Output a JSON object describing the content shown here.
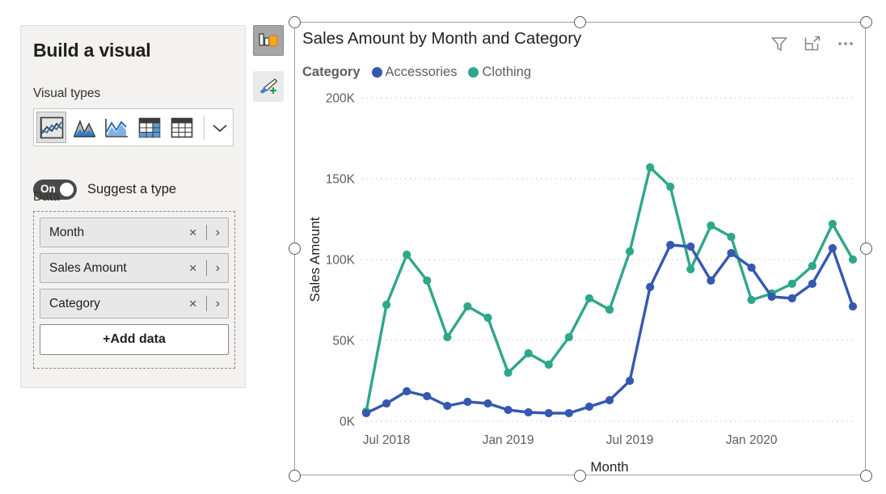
{
  "build_pane": {
    "title": "Build a visual",
    "visual_types_label": "Visual types",
    "data_label": "Data",
    "visual_types": [
      {
        "name": "line-chart",
        "selected": true
      },
      {
        "name": "area-chart",
        "selected": false
      },
      {
        "name": "line-and-stacked-area-chart",
        "selected": false
      },
      {
        "name": "matrix",
        "selected": false
      },
      {
        "name": "table",
        "selected": false
      }
    ],
    "more_visual_types_icon": "chevron-down-icon",
    "suggest_toggle": {
      "state_text": "On",
      "label": "Suggest a type",
      "on": true
    },
    "fields": [
      {
        "name": "Month",
        "remove_icon": "×",
        "expand_icon": "›"
      },
      {
        "name": "Sales Amount",
        "remove_icon": "×",
        "expand_icon": "›"
      },
      {
        "name": "Category",
        "remove_icon": "×",
        "expand_icon": "›"
      }
    ],
    "add_data_label": "+Add data"
  },
  "rail": {
    "build_icon": "build-visual-icon",
    "format_icon": "format-paint-brush-icon"
  },
  "visual": {
    "title": "Sales Amount by Month and Category",
    "header_icons": [
      {
        "name": "filter-icon"
      },
      {
        "name": "focus-mode-icon"
      },
      {
        "name": "more-options-icon",
        "label": "•••"
      }
    ]
  },
  "colors": {
    "accessories": "#3559b0",
    "clothing": "#2fa78a",
    "gridline": "#d4d2d0",
    "axis_text": "#605e5c",
    "title_text": "#252423",
    "pane_bg": "#f3f2f1",
    "frame_border": "#9e9e9e"
  },
  "chart_data": {
    "type": "line",
    "title": "Sales Amount by Month and Category",
    "xlabel": "Month",
    "ylabel": "Sales Amount",
    "legend_title": "Category",
    "legend_position": "top",
    "grid": true,
    "ylim": [
      0,
      200000
    ],
    "yticks": [
      0,
      50000,
      100000,
      150000,
      200000
    ],
    "ytick_labels": [
      "0K",
      "50K",
      "100K",
      "150K",
      "200K"
    ],
    "xtick_labels": [
      "Jul 2018",
      "Jan 2019",
      "Jul 2019",
      "Jan 2020"
    ],
    "xtick_indices": [
      1,
      7,
      13,
      19
    ],
    "x": [
      "Jun 2018",
      "Jul 2018",
      "Aug 2018",
      "Sep 2018",
      "Oct 2018",
      "Nov 2018",
      "Dec 2018",
      "Jan 2019",
      "Feb 2019",
      "Mar 2019",
      "Apr 2019",
      "May 2019",
      "Jun 2019",
      "Jul 2019",
      "Aug 2019",
      "Sep 2019",
      "Oct 2019",
      "Nov 2019",
      "Dec 2019",
      "Jan 2020",
      "Feb 2020",
      "Mar 2020",
      "Apr 2020",
      "May 2020",
      "Jun 2020"
    ],
    "series": [
      {
        "name": "Accessories",
        "color": "#3559b0",
        "values": [
          5000,
          11000,
          18500,
          15500,
          9500,
          12000,
          11000,
          7000,
          5500,
          5000,
          5000,
          9000,
          13000,
          25000,
          83000,
          109000,
          108000,
          87000,
          104000,
          95000,
          77000,
          76000,
          85000,
          107000,
          71000
        ]
      },
      {
        "name": "Clothing",
        "color": "#2fa78a",
        "values": [
          6000,
          72000,
          103000,
          87000,
          52000,
          71000,
          64000,
          30000,
          42000,
          35000,
          52000,
          76000,
          69000,
          105000,
          157000,
          145000,
          94000,
          121000,
          114000,
          75000,
          79000,
          85000,
          96000,
          122000,
          100000
        ]
      }
    ]
  }
}
